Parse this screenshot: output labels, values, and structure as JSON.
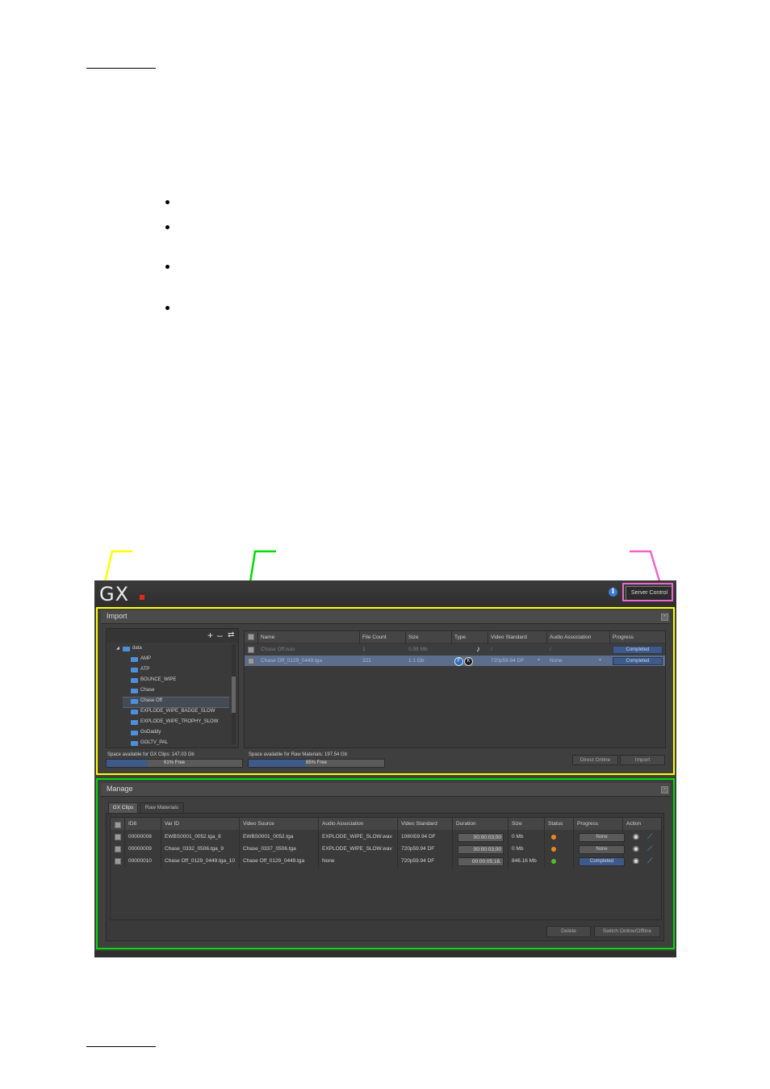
{
  "app": {
    "logo": "GX",
    "server_control": "Server Control"
  },
  "colors": {
    "import_callout": "#ffff00",
    "manage_callout": "#00dd00",
    "server_callout": "#ee66cc",
    "accent": "#3d5a8a",
    "status_orange": "#e88a1a",
    "status_green": "#5bb82e"
  },
  "import": {
    "title": "Import",
    "tree_tools": [
      "+",
      "–",
      "⇄"
    ],
    "tree": [
      {
        "label": "data",
        "root": true
      },
      {
        "label": "AMP"
      },
      {
        "label": "ATP"
      },
      {
        "label": "BOUNCE_WIPE"
      },
      {
        "label": "Chase"
      },
      {
        "label": "Chase Off",
        "selected": true
      },
      {
        "label": "EXPLODE_WIPE_BADGE_SLOW"
      },
      {
        "label": "EXPLODE_WIPE_TROPHY_SLOW"
      },
      {
        "label": "GoDaddy"
      },
      {
        "label": "GOLTV_PAL"
      }
    ],
    "columns": [
      "Name",
      "File Count",
      "Size",
      "Type",
      "Video Standard",
      "Audio Association",
      "Progress"
    ],
    "rows": [
      {
        "name": "Chase Off.wav",
        "file_count": "1",
        "size": "0.98 Mb",
        "type_icon": "music-note-icon",
        "video_standard": "/",
        "audio_association": "/",
        "progress": "Completed"
      },
      {
        "name": "Chase Off_0129_0449.tga",
        "file_count": "321",
        "size": "1.1 Gb",
        "type_icon": "fill-key-icons",
        "type_badges": [
          "F",
          "K"
        ],
        "video_standard": "720p59.94 DF",
        "audio_association": "None",
        "progress": "Completed"
      }
    ],
    "space_gx": "Space available for GX Clips: 147.03 Gb",
    "space_gx_bar": "61% Free",
    "space_gx_fraction": 0.61,
    "space_raw": "Space available for Raw Materials: 197.54 Gb",
    "space_raw_bar": "85% Free",
    "space_raw_fraction": 0.85,
    "direct_online": "Direct Online",
    "import_button": "Import"
  },
  "manage": {
    "title": "Manage",
    "tabs": [
      "GX Clips",
      "Raw Materials"
    ],
    "columns": [
      "ID8",
      "Var ID",
      "Video Source",
      "Audio Association",
      "Video Standard",
      "Duration",
      "Size",
      "Status",
      "Progress",
      "Action"
    ],
    "rows": [
      {
        "id8": "00000008",
        "var_id": "EWBS0001_0052.tga_8",
        "video_source": "EWBS0001_0052.tga",
        "audio": "EXPLODE_WIPE_SLOW.wav",
        "standard": "1080i59.94 DF",
        "duration": "00:00:03;00",
        "size": "0 Mb",
        "status": "orange",
        "progress": "None"
      },
      {
        "id8": "00000009",
        "var_id": "Chase_0332_0506.tga_9",
        "video_source": "Chase_0337_0506.tga",
        "audio": "EXPLODE_WIPE_SLOW.wav",
        "standard": "720p59.94 DF",
        "duration": "00:00:03;00",
        "size": "0 Mb",
        "status": "orange",
        "progress": "None"
      },
      {
        "id8": "00000010",
        "var_id": "Chase Off_0129_0449.tga_10",
        "video_source": "Chase Off_0129_0449.tga",
        "audio": "None",
        "standard": "720p59.94 DF",
        "duration": "00:00:05;16.",
        "size": "846.16 Mb",
        "status": "green",
        "progress": "Completed"
      }
    ],
    "delete": "Delete",
    "switch": "Switch Online/Offline"
  }
}
